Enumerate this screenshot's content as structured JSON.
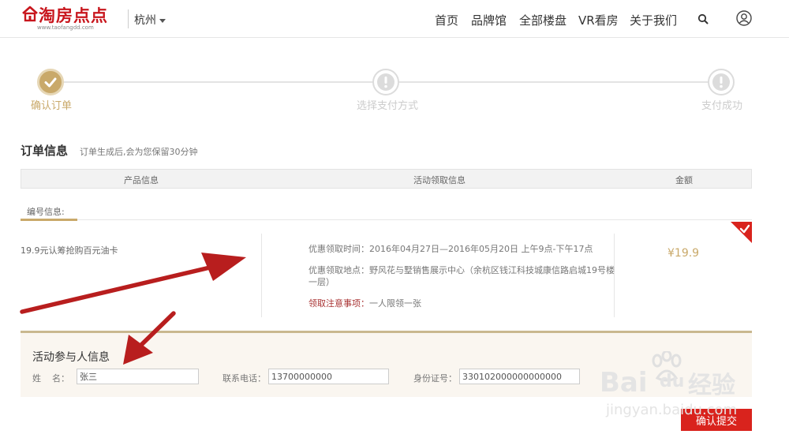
{
  "header": {
    "logo_text": "淘房点点",
    "logo_url": "www.taofangdd.com",
    "city": "杭州",
    "nav": [
      "首页",
      "品牌馆",
      "全部楼盘",
      "VR看房",
      "关于我们"
    ]
  },
  "steps": [
    {
      "label": "确认订单",
      "state": "done"
    },
    {
      "label": "选择支付方式",
      "state": "todo"
    },
    {
      "label": "支付成功",
      "state": "todo"
    }
  ],
  "order": {
    "title": "订单信息",
    "note": "订单生成后,会为您保留30分钟",
    "columns": [
      "产品信息",
      "活动领取信息",
      "金额"
    ],
    "code_label": "编号信息:",
    "product_name": "19.9元认筹抢购百元油卡",
    "time_label": "优惠领取时间：",
    "time_value": "2016年04月27日—2016年05月20日  上午9点-下午17点",
    "place_label": "优惠领取地点：",
    "place_value_line1": "野风花与墅销售展示中心（余杭区钱江科技城康信路启城19号楼",
    "place_value_line2": "一层）",
    "notice_label": "领取注意事项：",
    "notice_value": "一人限领一张",
    "price": "¥19.9"
  },
  "participant": {
    "title": "活动参与人信息",
    "name_label": "姓    名：",
    "name_value": "张三",
    "phone_label": "联系电话：",
    "phone_value": "13700000000",
    "id_label": "身份证号：",
    "id_value": "330102000000000000"
  },
  "submit_label": "确认提交",
  "watermark": {
    "line1": "Bai",
    "line1b": "du",
    "line1c": "经验",
    "line2": "jingyan.baidu.com"
  },
  "colors": {
    "brand_red": "#c8161d",
    "gold": "#c9a96a",
    "submit_red": "#d9231d",
    "arrow_red": "#b81e1e"
  }
}
